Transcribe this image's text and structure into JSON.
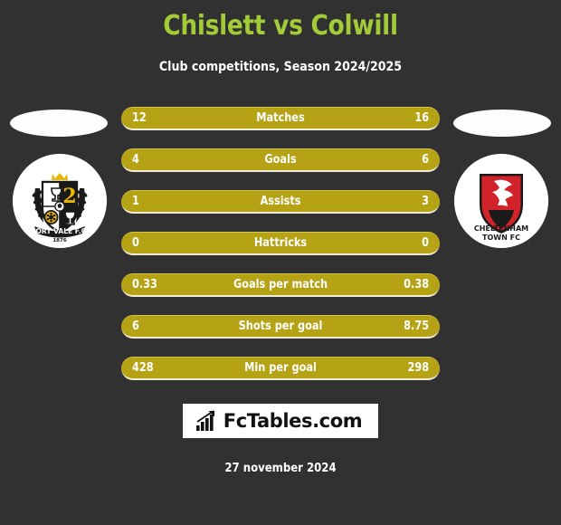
{
  "header": {
    "title": "Chislett vs Colwill",
    "subtitle": "Club competitions, Season 2024/2025",
    "title_color": "#a3cb38"
  },
  "home_team": {
    "name": "PORT VALE F.C.",
    "crest_name": "port-vale-fc-crest",
    "crest_year": "1876",
    "colors": {
      "primary": "#ffffff",
      "secondary": "#1a1a1a",
      "accent": "#e8b800"
    }
  },
  "away_team": {
    "name": "CHELTENHAM TOWN FC",
    "crest_name": "cheltenham-town-fc-crest",
    "crest_label_line1": "CHELTENHAM",
    "crest_label_line2": "TOWN FC",
    "colors": {
      "primary": "#d2232a",
      "secondary": "#1a1a1a",
      "accent": "#ffffff"
    }
  },
  "theme": {
    "background": "#313131",
    "bar_fill": "#b5a215",
    "bar_border_top": "#d8c44a",
    "bar_border_bottom": "#f2edd8",
    "text": "#ffffff"
  },
  "stats": [
    {
      "label": "Matches",
      "home": "12",
      "away": "16"
    },
    {
      "label": "Goals",
      "home": "4",
      "away": "6"
    },
    {
      "label": "Assists",
      "home": "1",
      "away": "3"
    },
    {
      "label": "Hattricks",
      "home": "0",
      "away": "0"
    },
    {
      "label": "Goals per match",
      "home": "0.33",
      "away": "0.38"
    },
    {
      "label": "Shots per goal",
      "home": "6",
      "away": "8.75"
    },
    {
      "label": "Min per goal",
      "home": "428",
      "away": "298"
    }
  ],
  "footer": {
    "brand": "FcTables.com",
    "brand_icon": "bar-chart-growth-icon",
    "date": "27 november 2024"
  }
}
